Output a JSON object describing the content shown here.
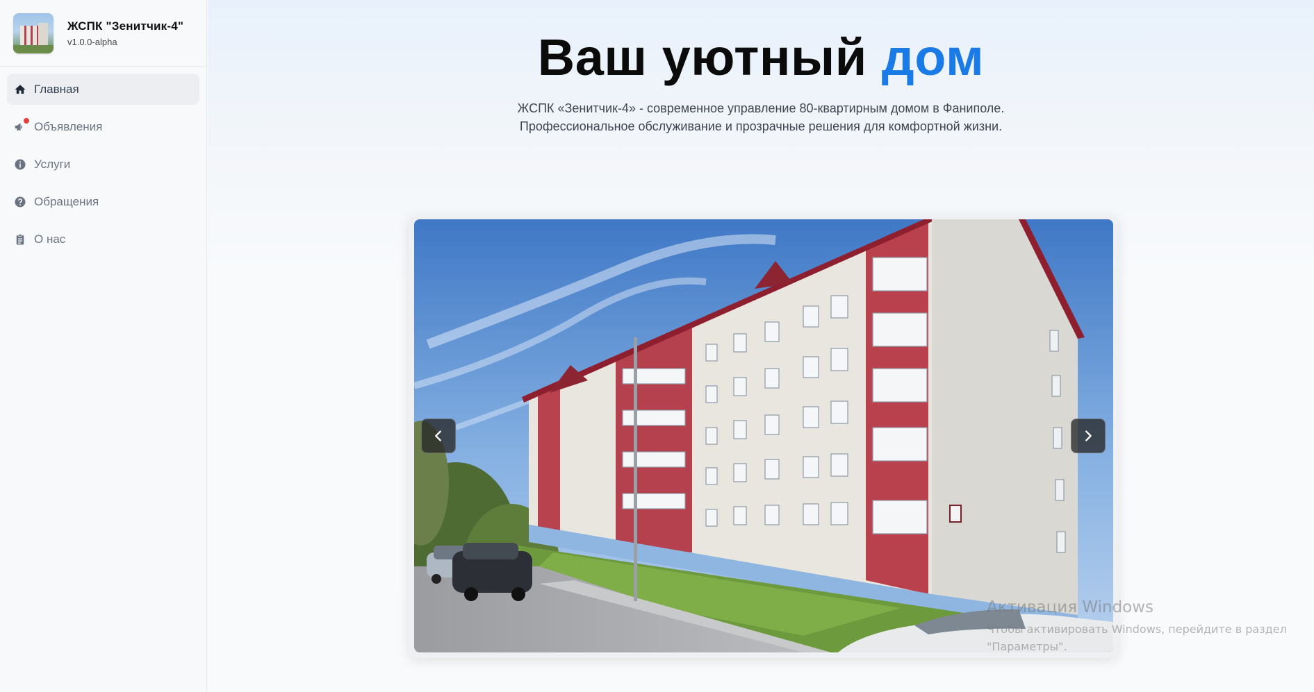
{
  "sidebar": {
    "brand": {
      "title": "ЖСПК \"Зенитчик-4\"",
      "version": "v1.0.0-alpha"
    },
    "items": [
      {
        "label": "Главная",
        "icon": "home-icon",
        "active": true
      },
      {
        "label": "Объявления",
        "icon": "megaphone-icon",
        "badge": true
      },
      {
        "label": "Услуги",
        "icon": "info-icon"
      },
      {
        "label": "Обращения",
        "icon": "question-icon"
      },
      {
        "label": "О нас",
        "icon": "clipboard-icon"
      }
    ]
  },
  "hero": {
    "title_main": "Ваш уютный",
    "title_accent": "дом",
    "subtitle_line1": "ЖСПК «Зенитчик-4» - современное управление 80-квартирным домом в Фаниполе.",
    "subtitle_line2": "Профессиональное обслуживание и прозрачные решения для комфортной жизни."
  },
  "carousel": {
    "image_name": "apartment-building-photo",
    "prev_icon": "chevron-left-icon",
    "next_icon": "chevron-right-icon"
  },
  "watermark": {
    "title": "Активация Windows",
    "line1": "Чтобы активировать Windows, перейдите в раздел",
    "line2": "\"Параметры\"."
  },
  "colors": {
    "accent": "#1a7be6",
    "badge": "#e53e3e",
    "sidebar_bg": "#f8f9fb",
    "active_item_bg": "#eceef2"
  }
}
